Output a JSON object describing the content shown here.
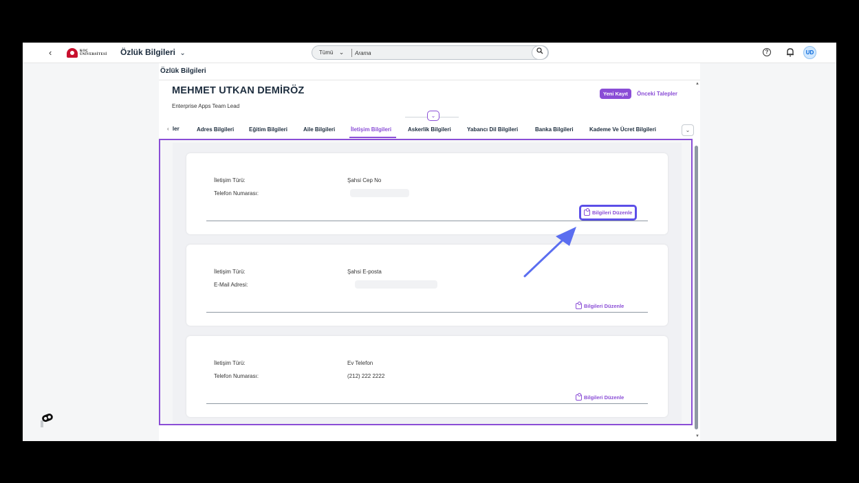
{
  "shell": {
    "back_glyph": "‹",
    "logo_text_line1": "KOÇ",
    "logo_text_line2": "ÜNİVERSİTESİ",
    "app_title": "Özlük Bilgileri",
    "app_title_chevron": "⌄",
    "search": {
      "scope": "Tümü",
      "scope_chevron": "⌄",
      "placeholder": "Arama",
      "search_glyph": "⚲"
    },
    "help_glyph": "?",
    "avatar_initials": "UD"
  },
  "page": {
    "title": "Özlük Bilgileri",
    "employee_name": "MEHMET UTKAN DEMİRÖZ",
    "employee_role": "Enterprise Apps Team Lead",
    "actions": {
      "new_record": "Yeni Kayıt",
      "previous_requests": "Önceki Talepler"
    },
    "collapse_glyph": "⌄",
    "tabs": {
      "left_nav_glyph": "‹",
      "partial_label": "ler",
      "items": [
        "Adres Bilgileri",
        "Eğitim Bilgileri",
        "Aile Bilgileri",
        "İletişim Bilgileri",
        "Askerlik Bilgileri",
        "Yabancı Dil Bilgileri",
        "Banka Bilgileri",
        "Kademe Ve Ücret Bilgileri"
      ],
      "active": "İletişim Bilgileri",
      "more_glyph": "⌄"
    },
    "cards": [
      {
        "type_label": "İletişim Türü:",
        "type_value": "Şahsi Cep No",
        "detail_label": "Telefon Numarası:",
        "detail_value": "",
        "edit_label": "Bilgileri Düzenle"
      },
      {
        "type_label": "İletişim Türü:",
        "type_value": "Şahsi E-posta",
        "detail_label": "E-Mail Adresi:",
        "detail_value": "",
        "edit_label": "Bilgileri Düzenle"
      },
      {
        "type_label": "İletişim Türü:",
        "type_value": "Ev Telefon",
        "detail_label": "Telefon Numarası:",
        "detail_value": "(212) 222 2222",
        "edit_label": "Bilgileri Düzenle"
      }
    ]
  },
  "colors": {
    "accent": "#8a4dd6",
    "highlight": "#5b4ee8",
    "text": "#1d2d3e",
    "background": "#f5f6f7"
  }
}
